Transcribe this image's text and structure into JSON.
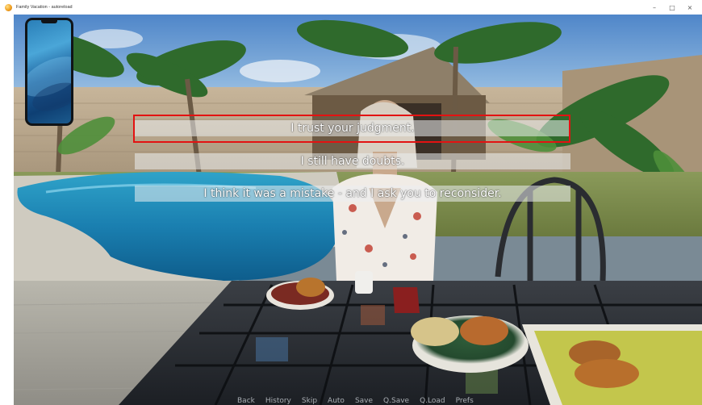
{
  "window": {
    "title": "Family Vacation - autoreload",
    "minimize_symbol": "–",
    "maximize_symbol": "□",
    "close_symbol": "×"
  },
  "phone": {
    "icon": "smartphone-icon"
  },
  "choices": [
    {
      "label": "I trust your judgment.",
      "highlighted": true
    },
    {
      "label": "I still have doubts.",
      "highlighted": false
    },
    {
      "label": "I think it was a mistake - and I ask you to reconsider.",
      "highlighted": false
    }
  ],
  "quick_menu": [
    "Back",
    "History",
    "Skip",
    "Auto",
    "Save",
    "Q.Save",
    "Q.Load",
    "Prefs"
  ],
  "colors": {
    "highlight_border": "#e31212",
    "choice_background": "rgba(235,238,240,0.55)",
    "choice_text": "#ffffff"
  }
}
